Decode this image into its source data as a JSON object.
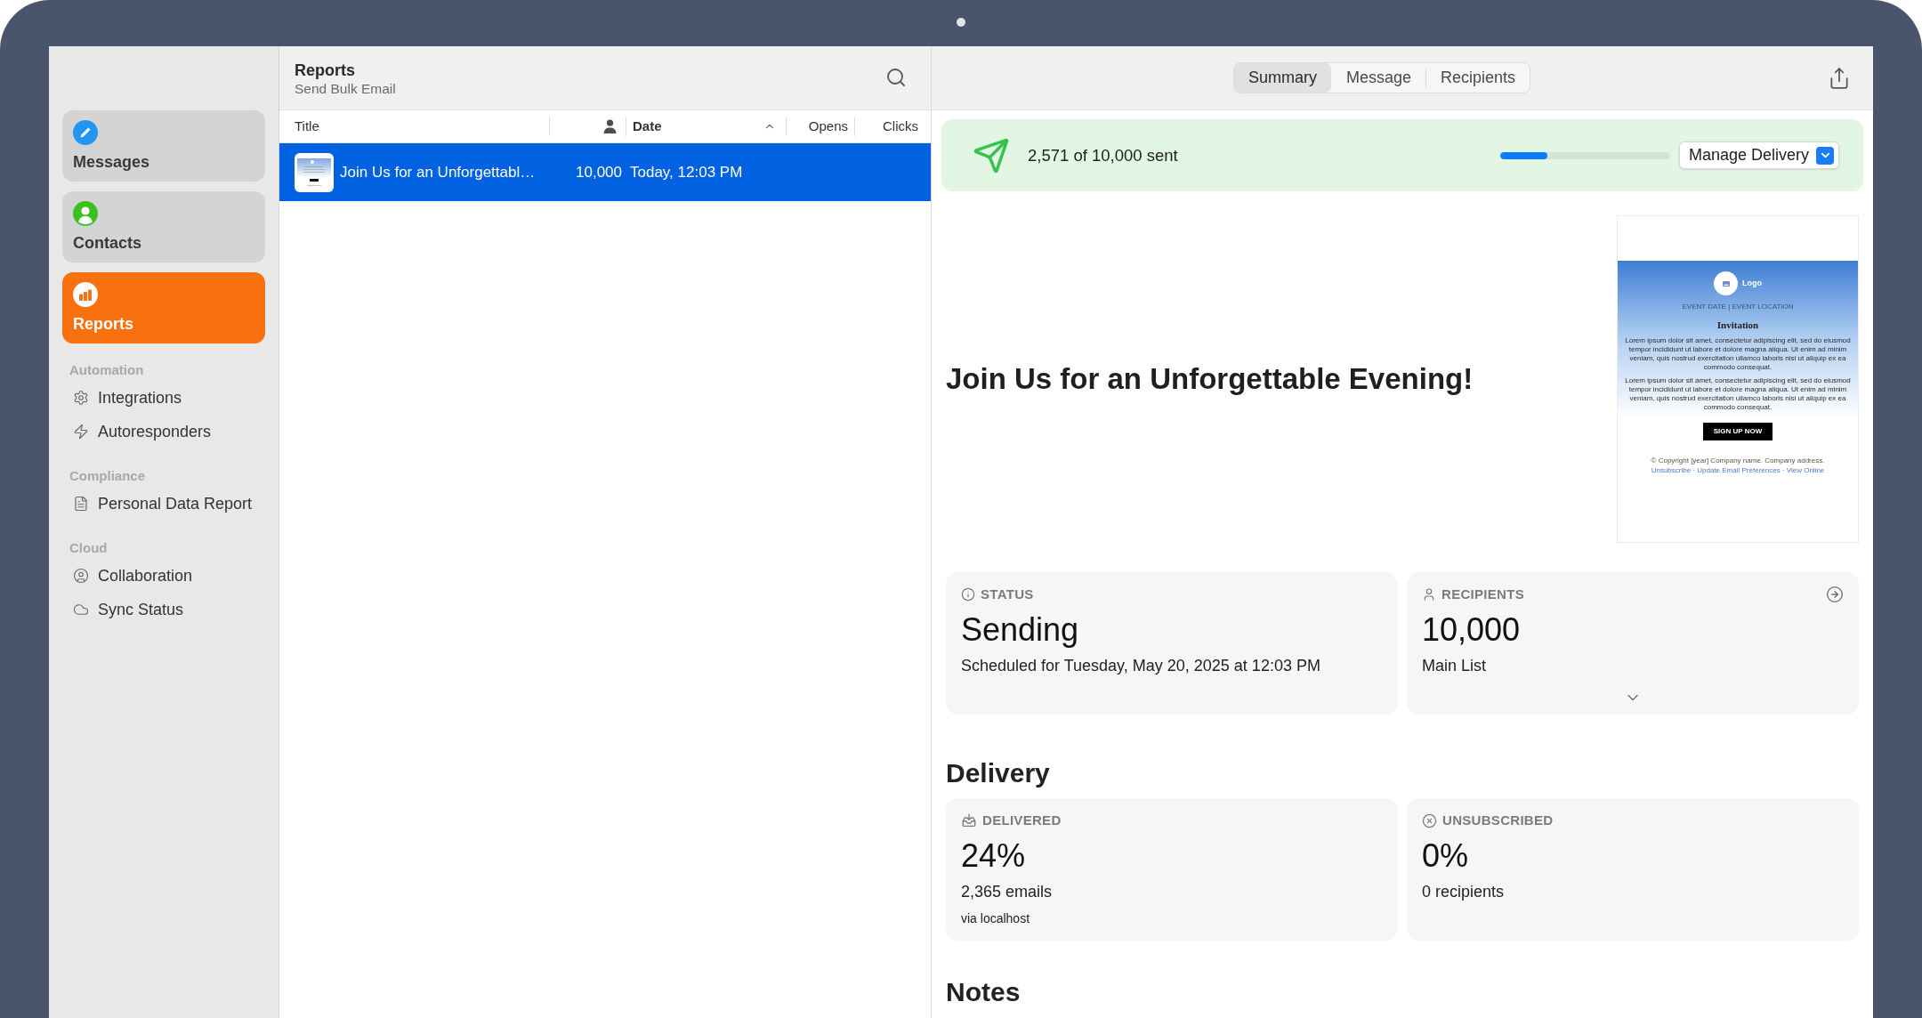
{
  "sidebar": {
    "cards": [
      {
        "label": "Messages",
        "color": "#2196f3",
        "selected": false
      },
      {
        "label": "Contacts",
        "color": "#3dbf1f",
        "selected": false
      },
      {
        "label": "Reports",
        "color": "#f9700f",
        "selected": true
      }
    ],
    "sections": [
      {
        "title": "Automation",
        "items": [
          "Integrations",
          "Autoresponders"
        ]
      },
      {
        "title": "Compliance",
        "items": [
          "Personal Data Report"
        ]
      },
      {
        "title": "Cloud",
        "items": [
          "Collaboration",
          "Sync Status"
        ]
      }
    ]
  },
  "list_pane": {
    "title": "Reports",
    "subtitle": "Send Bulk Email",
    "columns": [
      {
        "kind": "text",
        "label": "Title",
        "sorted": false
      },
      {
        "kind": "icon",
        "sorted": false
      },
      {
        "kind": "text",
        "label": "Date",
        "sorted": true
      },
      {
        "kind": "text",
        "label": "Opens",
        "sorted": false
      },
      {
        "kind": "text",
        "label": "Clicks",
        "sorted": false
      }
    ],
    "rows": [
      {
        "title": "Join Us for an Unforgettabl…",
        "recipients": "10,000",
        "date": "Today, 12:03 PM",
        "selected": true
      }
    ]
  },
  "detail_pane": {
    "tabs": [
      {
        "label": "Summary",
        "selected": true
      },
      {
        "label": "Message",
        "selected": false
      },
      {
        "label": "Recipients",
        "selected": false
      }
    ],
    "delivery_banner": {
      "text": "2,571 of 10,000 sent",
      "level": 0.28,
      "button": "Manage Delivery"
    },
    "message_title": "Join Us for an Unforgettable Evening!",
    "email_preview": {
      "logo": "Logo",
      "event_line": "EVENT DATE | EVENT LOCATION",
      "heading": "Invitation",
      "paragraphs": [
        "Lorem ipsum dolor sit amet, consectetur adipiscing elit, sed do eiusmod tempor incididunt ut labore et dolore magna aliqua. Ut enim ad minim veniam, quis nostrud exercitation ullamco laboris nisi ut aliquip ex ea commodo consequat.",
        "Lorem ipsum dolor sit amet, consectetur adipiscing elit, sed do eiusmod tempor incididunt ut labore et dolore magna aliqua. Ut enim ad minim veniam, quis nostrud exercitation ullamco laboris nisi ut aliquip ex ea commodo consequat."
      ],
      "button": "SIGN UP NOW",
      "footer": [
        "© Copyright [year] Company name. Company address.",
        "Unsubscribe · Update Email Preferences · View Online"
      ]
    },
    "summary_cards": [
      {
        "kind": "status",
        "label": "STATUS",
        "value": "Sending",
        "detail": "Scheduled for Tuesday, May 20, 2025 at 12:03 PM"
      },
      {
        "kind": "list",
        "label": "RECIPIENTS",
        "value": "10,000",
        "detail": "Main List"
      }
    ],
    "delivery": {
      "heading": "Delivery",
      "cards": [
        {
          "label": "DELIVERED",
          "value": "24%",
          "detail": "2,365 emails",
          "note": "via localhost"
        },
        {
          "label": "UNSUBSCRIBED",
          "value": "0%",
          "detail": "0 recipients"
        }
      ]
    },
    "notes": {
      "heading": "Notes"
    }
  }
}
